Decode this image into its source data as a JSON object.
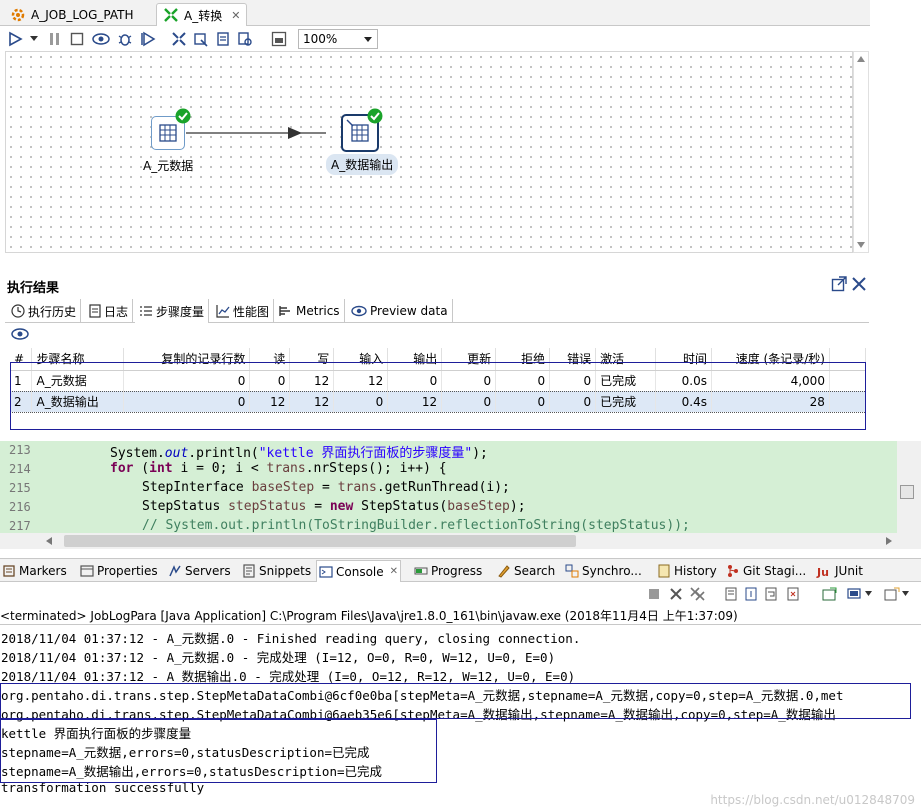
{
  "editor_tabs": [
    {
      "label": "A_JOB_LOG_PATH",
      "active": false
    },
    {
      "label": "A_转换",
      "active": true
    }
  ],
  "toolbar": {
    "zoom_value": "100%"
  },
  "canvas": {
    "steps": [
      {
        "label": "A_元数据",
        "status": "ok"
      },
      {
        "label": "A_数据输出",
        "status": "ok"
      }
    ]
  },
  "results": {
    "title": "执行结果",
    "tabs": [
      {
        "label": "执行历史",
        "icon": "history-icon"
      },
      {
        "label": "日志",
        "icon": "log-icon"
      },
      {
        "label": "步骤度量",
        "icon": "step-metrics-icon",
        "active": true
      },
      {
        "label": "性能图",
        "icon": "chart-icon"
      },
      {
        "label": "Metrics",
        "icon": "metrics-icon"
      },
      {
        "label": "Preview data",
        "icon": "eye-icon"
      }
    ],
    "columns": [
      "#",
      "步骤名称",
      "复制的记录行数",
      "读",
      "写",
      "输入",
      "输出",
      "更新",
      "拒绝",
      "错误",
      "激活",
      "时间",
      "速度 (条记录/秒)"
    ],
    "rows": [
      [
        "1",
        "A_元数据",
        "0",
        "0",
        "12",
        "12",
        "0",
        "0",
        "0",
        "0",
        "已完成",
        "0.0s",
        "4,000"
      ],
      [
        "2",
        "A_数据输出",
        "0",
        "12",
        "12",
        "0",
        "12",
        "0",
        "0",
        "0",
        "已完成",
        "0.4s",
        "28"
      ]
    ]
  },
  "code": {
    "line_numbers": [
      "213",
      "214",
      "215",
      "216",
      "217"
    ],
    "lines": [
      "System.out.println(\"kettle 界面执行面板的步骤度量\");",
      "for (int i = 0; i < trans.nrSteps(); i++) {",
      "StepInterface baseStep = trans.getRunThread(i);",
      "StepStatus stepStatus = new StepStatus(baseStep);",
      "// System.out.println(ToStringBuilder.reflectionToString(stepStatus));"
    ],
    "tokens": {
      "system": "System.",
      "out": "out",
      "println_open": ".println(",
      "str_213": "\"kettle 界面执行面板的步骤度量\"",
      "close_213": ");",
      "for": "for",
      "paren_open": " (",
      "int": "int",
      "i_init": " i = 0; i < ",
      "trans1": "trans",
      "nrsteps": ".nrSteps(); i++) {",
      "stepinterface": "StepInterface ",
      "basestep1": "baseStep",
      "eq1": " = ",
      "trans2": "trans",
      "getrun": ".getRunThread(i);",
      "stepstatus_type": "StepStatus ",
      "stepstatus_var": "stepStatus",
      "eq2": " = ",
      "new": "new",
      "stepstatus_ctor": " StepStatus(",
      "basestep2": "baseStep",
      "close_216": ");",
      "comment_217": "// System.out.println(ToStringBuilder.reflectionToString(stepStatus));"
    }
  },
  "views": {
    "tabs": [
      {
        "label": "Markers",
        "icon": "markers-icon"
      },
      {
        "label": "Properties",
        "icon": "properties-icon"
      },
      {
        "label": "Servers",
        "icon": "servers-icon"
      },
      {
        "label": "Snippets",
        "icon": "snippets-icon"
      },
      {
        "label": "Console",
        "icon": "console-icon",
        "active": true
      },
      {
        "label": "Progress",
        "icon": "progress-icon"
      },
      {
        "label": "Search",
        "icon": "search-icon"
      },
      {
        "label": "Synchro...",
        "icon": "synchronize-icon"
      },
      {
        "label": "History",
        "icon": "history-icon"
      },
      {
        "label": "Git Stagi...",
        "icon": "git-icon"
      },
      {
        "label": "JUnit",
        "icon": "junit-icon"
      }
    ]
  },
  "console": {
    "terminated": "<terminated> JobLogPara [Java Application] C:\\Program Files\\Java\\jre1.8.0_161\\bin\\javaw.exe (2018年11月4日 上午1:37:09)",
    "lines": [
      "2018/11/04 01:37:12 - A_元数据.0 - Finished reading query, closing connection.",
      "2018/11/04 01:37:12 - A_元数据.0 - 完成处理 (I=12, O=0, R=0, W=12, U=0, E=0)",
      "2018/11/04 01:37:12 - A_数据输出.0 - 完成处理 (I=0, O=12, R=12, W=12, U=0, E=0)",
      "org.pentaho.di.trans.step.StepMetaDataCombi@6cf0e0ba[stepMeta=A_元数据,stepname=A_元数据,copy=0,step=A_元数据.0,met",
      "org.pentaho.di.trans.step.StepMetaDataCombi@6aeb35e6[stepMeta=A_数据输出,stepname=A_数据输出,copy=0,step=A_数据输出",
      "kettle 界面执行面板的步骤度量",
      "stepname=A_元数据,errors=0,statusDescription=已完成",
      "stepname=A_数据输出,errors=0,statusDescription=已完成",
      "transformation successfully"
    ]
  },
  "watermark": "https://blog.csdn.net/u012848709",
  "colors": {
    "accent": "#1e1e9a",
    "ok": "#1aa32a",
    "code_bg": "#d5efd5"
  }
}
